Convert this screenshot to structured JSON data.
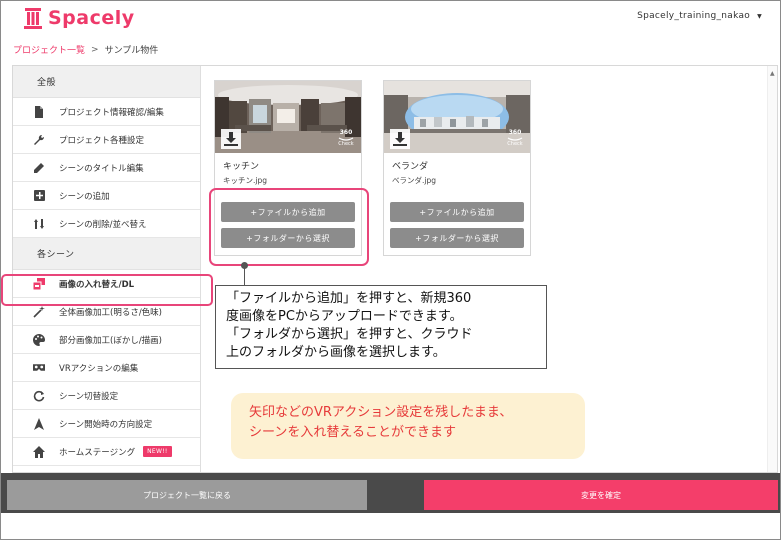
{
  "header": {
    "logo_text": "Spacely",
    "user_name": "Spacely_training_nakao",
    "user_caret": "▼"
  },
  "breadcrumb": {
    "root": "プロジェクト一覧",
    "separator": ">",
    "current": "サンプル物件"
  },
  "sidebar": {
    "section_general": "全般",
    "general_items": [
      {
        "label": "プロジェクト情報確認/編集",
        "icon": "document-icon"
      },
      {
        "label": "プロジェクト各種設定",
        "icon": "wrench-icon"
      },
      {
        "label": "シーンのタイトル編集",
        "icon": "pencil-icon"
      },
      {
        "label": "シーンの追加",
        "icon": "plus-square-icon"
      },
      {
        "label": "シーンの削除/並べ替え",
        "icon": "sort-icon"
      }
    ],
    "section_scenes": "各シーン",
    "scene_items": [
      {
        "label": "画像の入れ替え/DL",
        "icon": "image-swap-icon"
      },
      {
        "label": "全体画像加工(明るさ/色味)",
        "icon": "wand-icon"
      },
      {
        "label": "部分画像加工(ぼかし/描画)",
        "icon": "palette-icon"
      },
      {
        "label": "VRアクションの編集",
        "icon": "vr-icon"
      },
      {
        "label": "シーン切替設定",
        "icon": "refresh-icon"
      },
      {
        "label": "シーン開始時の方向設定",
        "icon": "navigation-icon"
      },
      {
        "label": "ホームステージング",
        "icon": "home-icon"
      }
    ],
    "new_badge": "NEW!!"
  },
  "cards": [
    {
      "title": "キッチン",
      "file": "キッチン.jpg",
      "add_file": "+ファイルから追加",
      "select_folder": "+フォルダーから選択",
      "check_label": "Check",
      "check_num": "360"
    },
    {
      "title": "ベランダ",
      "file": "ベランダ.jpg",
      "add_file": "+ファイルから追加",
      "select_folder": "+フォルダーから選択",
      "check_label": "Check",
      "check_num": "360"
    }
  ],
  "callout": {
    "line1": "「ファイルから追加」を押すと、新規360",
    "line2": "度画像をPCからアップロードできます。",
    "line3": "「フォルダから選択」を押すと、クラウド",
    "line4": "上のフォルダから画像を選択します。"
  },
  "note": {
    "line1": "矢印などのVRアクション設定を残したまま、",
    "line2": "シーンを入れ替えることができます"
  },
  "footer": {
    "back_label": "プロジェクト一覧に戻る",
    "confirm_label": "変更を確定"
  },
  "colors": {
    "brand": "#ee3a6a",
    "confirm": "#f43e6a",
    "highlight": "#e8457a",
    "note_text": "#e63a3a",
    "note_bg": "#fdf1d2"
  }
}
